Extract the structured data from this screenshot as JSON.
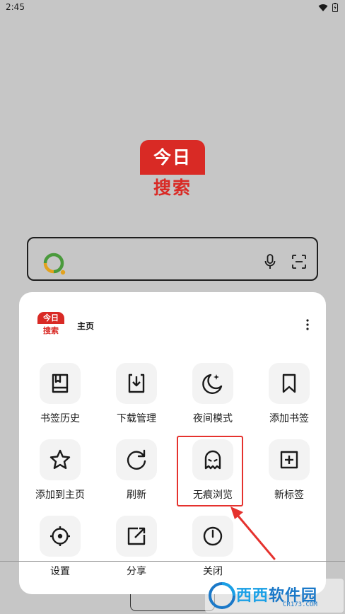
{
  "status_bar": {
    "time": "2:45"
  },
  "logo": {
    "top_text": "今日",
    "bottom_text": "搜索"
  },
  "search": {
    "placeholder": ""
  },
  "menu": {
    "header_logo_top": "今日",
    "header_logo_bottom": "搜索",
    "title": "主页",
    "items": [
      {
        "label": "书签历史",
        "icon": "bookmark-history-icon"
      },
      {
        "label": "下载管理",
        "icon": "download-icon"
      },
      {
        "label": "夜间模式",
        "icon": "moon-icon"
      },
      {
        "label": "添加书签",
        "icon": "bookmark-icon"
      },
      {
        "label": "添加到主页",
        "icon": "star-icon"
      },
      {
        "label": "刷新",
        "icon": "refresh-icon"
      },
      {
        "label": "无痕浏览",
        "icon": "ghost-icon"
      },
      {
        "label": "新标签",
        "icon": "new-tab-icon"
      },
      {
        "label": "设置",
        "icon": "settings-icon"
      },
      {
        "label": "分享",
        "icon": "share-icon"
      },
      {
        "label": "关闭",
        "icon": "power-icon"
      }
    ]
  },
  "watermark": {
    "brand_a": "西西",
    "brand_b": "软件园",
    "url": "CR173.COM"
  },
  "colors": {
    "brand_red": "#d92a25",
    "highlight": "#e5322e",
    "background": "#c6c6c6"
  }
}
